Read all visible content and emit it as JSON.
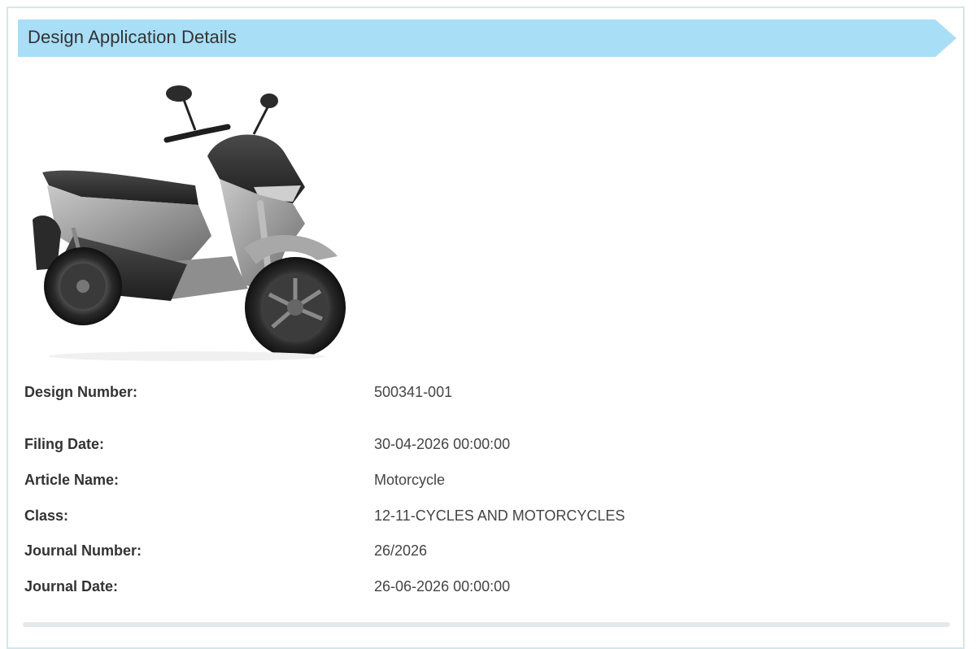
{
  "header": {
    "title": "Design Application Details"
  },
  "product": {
    "image_name": "scooter-illustration"
  },
  "details": [
    {
      "label": "Design Number:",
      "value": "500341-001"
    },
    {
      "label": "Filing Date:",
      "value": "30-04-2026 00:00:00"
    },
    {
      "label": "Article Name:",
      "value": "Motorcycle"
    },
    {
      "label": "Class:",
      "value": "12-11-CYCLES AND MOTORCYCLES"
    },
    {
      "label": "Journal Number:",
      "value": "26/2026"
    },
    {
      "label": "Journal Date:",
      "value": "26-06-2026 00:00:00"
    }
  ],
  "colors": {
    "header_bg": "#a9def7",
    "frame_border": "#d5e6ea",
    "label_text": "#333333",
    "value_text": "#444444"
  }
}
